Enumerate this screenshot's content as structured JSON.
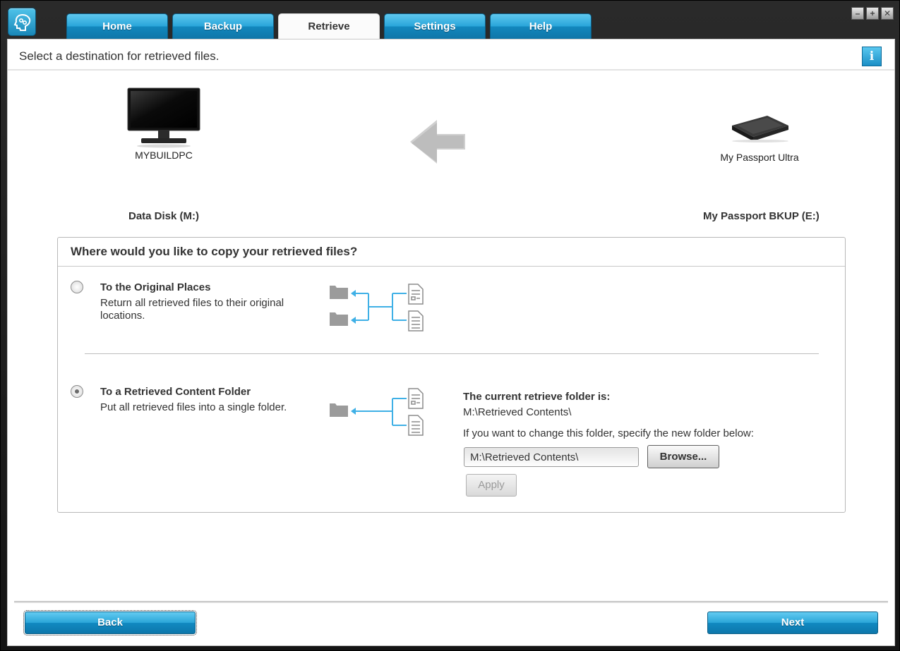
{
  "tabs": [
    {
      "label": "Home",
      "active": false
    },
    {
      "label": "Backup",
      "active": false
    },
    {
      "label": "Retrieve",
      "active": true
    },
    {
      "label": "Settings",
      "active": false
    },
    {
      "label": "Help",
      "active": false
    }
  ],
  "window_controls": {
    "minimize": "–",
    "maximize": "+",
    "close": "✕"
  },
  "header": {
    "title": "Select a destination for retrieved files.",
    "info_icon": "i"
  },
  "source_device": {
    "name": "MYBUILDPC",
    "disk": "Data Disk (M:)",
    "icon": "monitor-icon"
  },
  "target_device": {
    "name": "My Passport Ultra",
    "disk": "My Passport BKUP (E:)",
    "icon": "external-drive-icon"
  },
  "panel": {
    "title": "Where would you like to copy your retrieved files?",
    "options": [
      {
        "title": "To the Original Places",
        "desc_line1": "Return all retrieved files to their original",
        "desc_line2": "locations.",
        "selected": false
      },
      {
        "title": "To a Retrieved Content Folder",
        "desc_line1": "Put all retrieved files into a single folder.",
        "selected": true
      }
    ],
    "current_folder_label": "The current retrieve folder is:",
    "current_folder_path": "M:\\Retrieved Contents\\",
    "change_label": "If you want to change this folder, specify the new folder below:",
    "folder_input_value": "M:\\Retrieved Contents\\",
    "browse_label": "Browse...",
    "apply_label": "Apply"
  },
  "footer": {
    "back_label": "Back",
    "next_label": "Next"
  },
  "colors": {
    "accent": "#2aa6da",
    "arrow_blue": "#3fb0e6",
    "icon_gray": "#9b9b9b"
  }
}
